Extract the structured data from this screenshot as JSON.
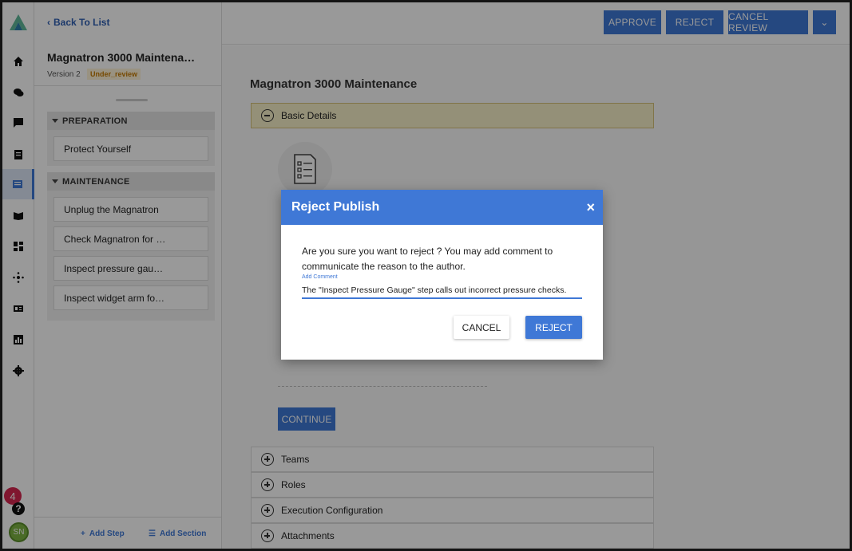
{
  "outline": {
    "back_label": "Back To List",
    "title": "Magnatron 3000 Maintena…",
    "version": "Version 2",
    "status": "Under_review",
    "sections": [
      {
        "label": "PREPARATION",
        "steps": [
          "Protect Yourself"
        ]
      },
      {
        "label": "MAINTENANCE",
        "steps": [
          "Unplug the Magnatron",
          "Check Magnatron for …",
          "Inspect pressure gau…",
          "Inspect widget arm fo…"
        ]
      }
    ],
    "add_step": "Add Step",
    "add_section": "Add Section"
  },
  "rail": {
    "notification_count": "4",
    "help": "?",
    "avatar_initials": "SN"
  },
  "toolbar": {
    "approve": "APPROVE",
    "reject": "REJECT",
    "cancel_review": "CANCEL REVIEW"
  },
  "main": {
    "title": "Magnatron 3000 Maintenance",
    "basic_details": "Basic Details",
    "continue": "CONTINUE",
    "accordions": [
      "Teams",
      "Roles",
      "Execution Configuration",
      "Attachments"
    ]
  },
  "modal": {
    "title": "Reject Publish",
    "close": "×",
    "message": "Are you sure you want to reject ? You may add comment to communicate the reason to the author.",
    "comment_label": "Add Comment",
    "comment_value": "The \"Inspect Pressure Gauge\" step calls out incorrect pressure checks.",
    "cancel": "CANCEL",
    "reject": "REJECT"
  },
  "colors": {
    "accent": "#3f78d6",
    "status": "#c57a00",
    "badge": "#d6254f",
    "highlight": "#f7f0c8"
  }
}
